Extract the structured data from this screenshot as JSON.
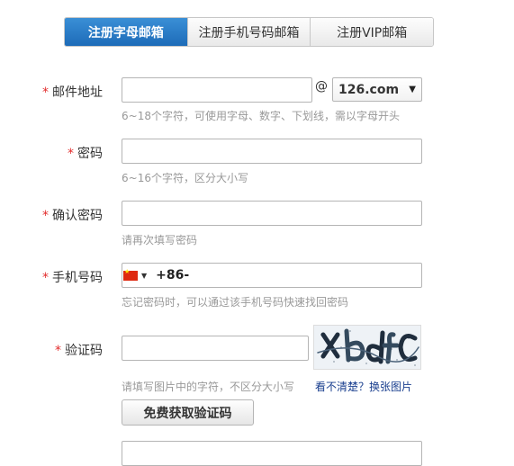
{
  "tabs": [
    {
      "label": "注册字母邮箱",
      "active": true
    },
    {
      "label": "注册手机号码邮箱",
      "active": false
    },
    {
      "label": "注册VIP邮箱",
      "active": false
    }
  ],
  "required_mark": "*",
  "email": {
    "label": "邮件地址",
    "value": "",
    "at": "@",
    "domain": "126.com",
    "hint": "6~18个字符，可使用字母、数字、下划线，需以字母开头"
  },
  "password": {
    "label": "密码",
    "value": "",
    "hint": "6~16个字符，区分大小写"
  },
  "confirm_password": {
    "label": "确认密码",
    "value": "",
    "hint": "请再次填写密码"
  },
  "phone": {
    "label": "手机号码",
    "prefix": "+86-",
    "value": "",
    "hint": "忘记密码时，可以通过该手机号码快速找回密码"
  },
  "captcha": {
    "label": "验证码",
    "value": "",
    "refresh_link": "看不清楚？换张图片",
    "hint": "请填写图片中的字符，不区分大小写"
  },
  "sms_button": "免费获取验证码",
  "colors": {
    "active_tab": "#1d6bb8",
    "required": "#e22c2c",
    "link": "#1a3f8f",
    "hint": "#999999"
  }
}
